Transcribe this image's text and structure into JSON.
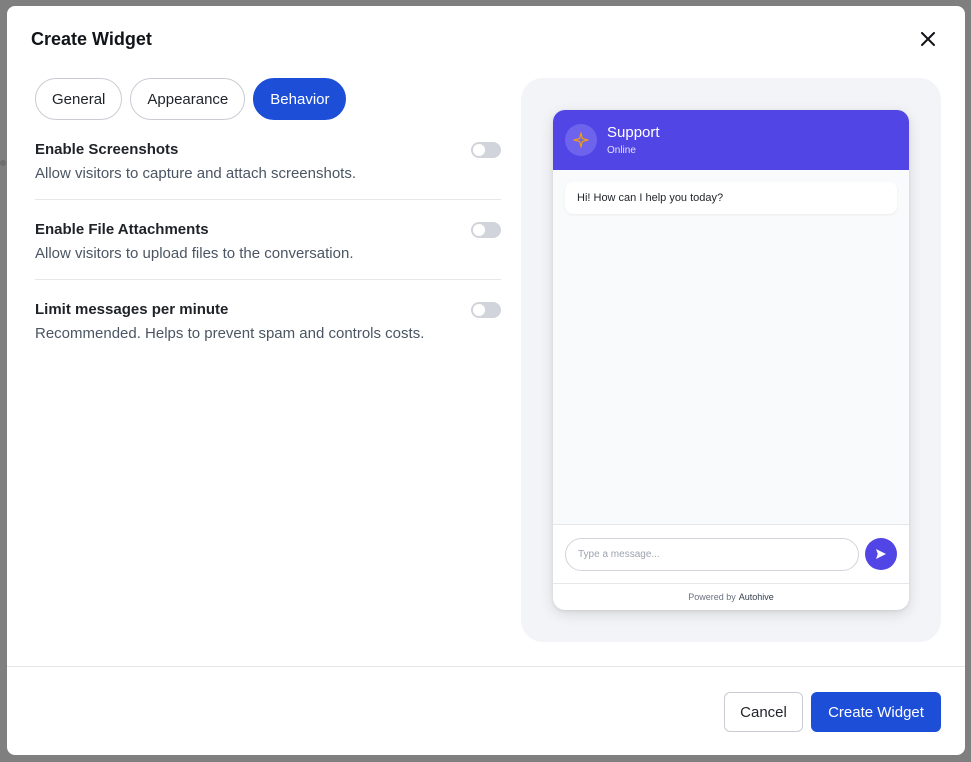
{
  "modal": {
    "title": "Create Widget"
  },
  "tabs": [
    {
      "label": "General",
      "active": false
    },
    {
      "label": "Appearance",
      "active": false
    },
    {
      "label": "Behavior",
      "active": true
    }
  ],
  "settings": [
    {
      "title": "Enable Screenshots",
      "description": "Allow visitors to capture and attach screenshots.",
      "enabled": false
    },
    {
      "title": "Enable File Attachments",
      "description": "Allow visitors to upload files to the conversation.",
      "enabled": false
    },
    {
      "title": "Limit messages per minute",
      "description": "Recommended. Helps to prevent spam and controls costs.",
      "enabled": false
    }
  ],
  "preview": {
    "header_title": "Support",
    "header_status": "Online",
    "welcome_message": "Hi! How can I help you today?",
    "input_placeholder": "Type a message...",
    "powered_by": "Powered by",
    "brand": "Autohive",
    "avatar_icon": "sparkle-icon",
    "send_icon": "send-icon"
  },
  "footer": {
    "cancel_label": "Cancel",
    "create_label": "Create Widget"
  },
  "colors": {
    "primary": "#1d4ed8",
    "chat_header": "#5145e6",
    "toggle_off": "#d1d5db",
    "sparkle": "#f59e0b"
  }
}
